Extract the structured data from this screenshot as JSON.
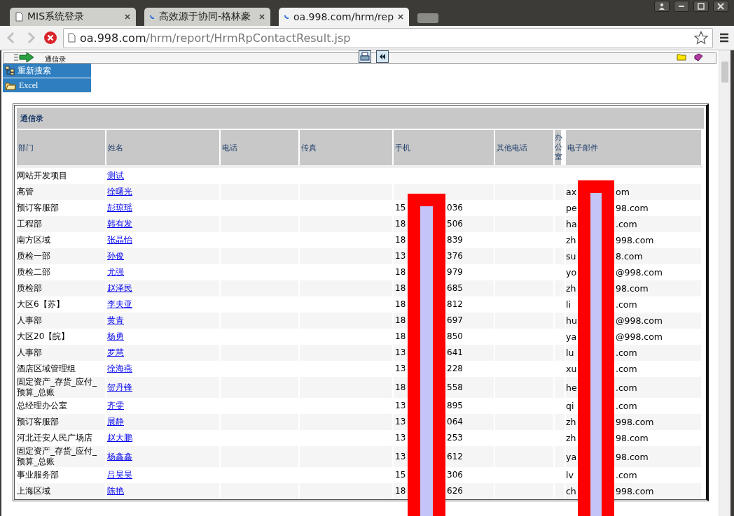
{
  "browser": {
    "tabs": [
      {
        "title": "MIS系统登录",
        "selected": false,
        "loading": false
      },
      {
        "title": "高效源于协同-格林豪",
        "selected": false,
        "loading": true
      },
      {
        "title": "oa.998.com/hrm/rep",
        "selected": true,
        "loading": true
      }
    ],
    "url_host": "oa.998.com",
    "url_path": "/hrm/report/HrmRpContactResult.jsp"
  },
  "toolbar": {
    "title": "通信录"
  },
  "menu": [
    {
      "label": "重新搜索",
      "kind": "tree"
    },
    {
      "label": "Excel",
      "kind": "excel"
    }
  ],
  "table": {
    "title": "通信录",
    "columns": [
      "部门",
      "姓名",
      "电话",
      "传真",
      "手机",
      "其他电话",
      "办公室",
      "电子邮件"
    ],
    "rows": [
      {
        "dept": "网站开发项目",
        "name": "测试"
      },
      {
        "dept": "高管",
        "name": "徐曙光",
        "email": {
          "start": "ax",
          "end": "om"
        }
      },
      {
        "dept": "预订客服部",
        "name": "彭琼瑶",
        "mobile": {
          "start": "15",
          "end": "036"
        },
        "email": {
          "start": "pe",
          "end": "98.com"
        }
      },
      {
        "dept": "工程部",
        "name": "韩有发",
        "mobile": {
          "start": "18",
          "end": "506"
        },
        "email": {
          "start": "ha",
          "end": ".com"
        }
      },
      {
        "dept": "南方区域",
        "name": "张晶怡",
        "mobile": {
          "start": "18",
          "end": "839"
        },
        "email": {
          "start": "zh",
          "end": "998.com"
        }
      },
      {
        "dept": "质检一部",
        "name": "孙俊",
        "mobile": {
          "start": "13",
          "end": "376"
        },
        "email": {
          "start": "su",
          "end": "8.com"
        }
      },
      {
        "dept": "质检二部",
        "name": "尤强",
        "mobile": {
          "start": "18",
          "end": "979"
        },
        "email": {
          "start": "yo",
          "end": "@998.com"
        }
      },
      {
        "dept": "质检部",
        "name": "赵泽民",
        "mobile": {
          "start": "18",
          "end": "685"
        },
        "email": {
          "start": "zh",
          "end": "98.com"
        }
      },
      {
        "dept": "大区6【苏】",
        "name": "李夫亚",
        "mobile": {
          "start": "18",
          "end": "812"
        },
        "email": {
          "start": "li",
          "end": ".com"
        }
      },
      {
        "dept": "人事部",
        "name": "黄青",
        "mobile": {
          "start": "18",
          "end": "697"
        },
        "email": {
          "start": "hu",
          "end": "@998.com"
        }
      },
      {
        "dept": "大区20【皖】",
        "name": "杨勇",
        "mobile": {
          "start": "18",
          "end": "850"
        },
        "email": {
          "start": "ya",
          "end": "@998.com"
        }
      },
      {
        "dept": "人事部",
        "name": "罗慧",
        "mobile": {
          "start": "13",
          "end": "641"
        },
        "email": {
          "start": "lu",
          "end": ".com"
        }
      },
      {
        "dept": "酒店区域管理组",
        "name": "徐海燕",
        "mobile": {
          "start": "13",
          "end": "228"
        },
        "email": {
          "start": "xu",
          "end": ".com"
        }
      },
      {
        "dept": "固定资产_存货_应付_预算_总账",
        "name": "贺丹锋",
        "mobile": {
          "start": "18",
          "end": "558"
        },
        "email": {
          "start": "he",
          "end": ".com"
        }
      },
      {
        "dept": "总经理办公室",
        "name": "齐雯",
        "mobile": {
          "start": "13",
          "end": "895"
        },
        "email": {
          "start": "qi",
          "end": ".com"
        }
      },
      {
        "dept": "预订客服部",
        "name": "展静",
        "mobile": {
          "start": "13",
          "end": "064"
        },
        "email": {
          "start": "zh",
          "end": "998.com"
        }
      },
      {
        "dept": "河北迁安人民广场店",
        "name": "赵大鹏",
        "mobile": {
          "start": "13",
          "end": "253"
        },
        "email": {
          "start": "zh",
          "end": "98.com"
        }
      },
      {
        "dept": "固定资产_存货_应付_预算_总账",
        "name": "杨鑫鑫",
        "mobile": {
          "start": "13",
          "end": "612"
        },
        "email": {
          "start": "ya",
          "end": "98.com"
        }
      },
      {
        "dept": "事业服务部",
        "name": "吕昊昊",
        "mobile": {
          "start": "15",
          "end": "306"
        },
        "email": {
          "start": "lv",
          "end": ".com"
        }
      },
      {
        "dept": "上海区域",
        "name": "陈艳",
        "mobile": {
          "start": "18",
          "end": "626"
        },
        "email": {
          "start": "ch",
          "end": "998.com"
        }
      }
    ]
  }
}
